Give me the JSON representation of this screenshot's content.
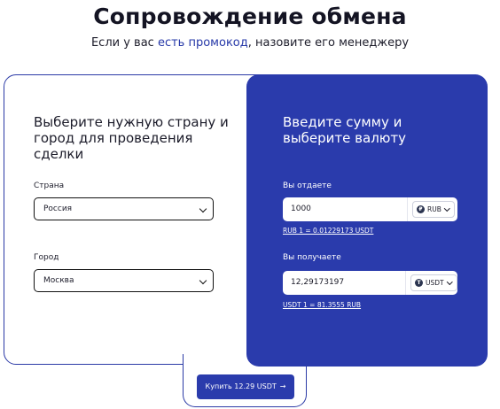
{
  "header": {
    "title": "Сопровождение обмена",
    "subtitle_before": "Если у вас ",
    "subtitle_link": "есть промокод",
    "subtitle_after": ", назовите его менеджеру"
  },
  "location": {
    "heading": "Выберите нужную страну и город для проведения сделки",
    "country_label": "Страна",
    "country_value": "Россия",
    "city_label": "Город",
    "city_value": "Москва"
  },
  "exchange": {
    "heading": "Введите сумму и выберите валюту",
    "give_label": "Вы отдаете",
    "give_amount": "1000",
    "give_currency": "RUB",
    "give_rate": "RUB 1 = 0.01229173 USDT",
    "receive_label": "Вы получаете",
    "receive_amount": "12,29173197",
    "receive_currency": "USDT",
    "receive_rate": "USDT 1 = 81.3555 RUB"
  },
  "action": {
    "buy_label": "Купить 12.29 USDT",
    "buy_arrow": "→"
  },
  "icons": {
    "give_currency_icon": "ruble-coin-icon",
    "receive_currency_icon": "tether-coin-icon",
    "coin_glyph_rub": "₽",
    "coin_glyph_usdt": "T"
  },
  "colors": {
    "accent": "#2a3bac",
    "link": "#2638a8",
    "text": "#1c1c2a"
  }
}
